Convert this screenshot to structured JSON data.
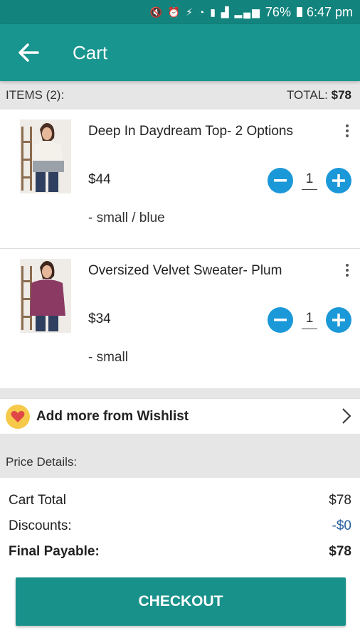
{
  "status_bar": {
    "battery": "76%",
    "time": "6:47 pm"
  },
  "header": {
    "title": "Cart",
    "back_icon": "arrow-left-icon"
  },
  "summary": {
    "items_label": "ITEMS (2):",
    "total_label": "TOTAL:",
    "total_value": "$78"
  },
  "items": [
    {
      "name": "Deep In Daydream Top- 2 Options",
      "price": "$44",
      "quantity": "1",
      "variant": "- small / blue"
    },
    {
      "name": "Oversized Velvet Sweater- Plum",
      "price": "$34",
      "quantity": "1",
      "variant": "- small"
    }
  ],
  "wishlist": {
    "label": "Add more from Wishlist"
  },
  "price_details": {
    "header": "Price Details:",
    "cart_total_label": "Cart Total",
    "cart_total_value": "$78",
    "discounts_label": "Discounts:",
    "discounts_value": "-$0",
    "final_label": "Final Payable:",
    "final_value": "$78"
  },
  "footer": {
    "checkout_label": "CHECKOUT"
  },
  "colors": {
    "status_bar": "#13837d",
    "app_bar": "#19958f",
    "qty_button": "#1b98d8",
    "checkout": "#19918b",
    "discount": "#2a5fa0"
  }
}
